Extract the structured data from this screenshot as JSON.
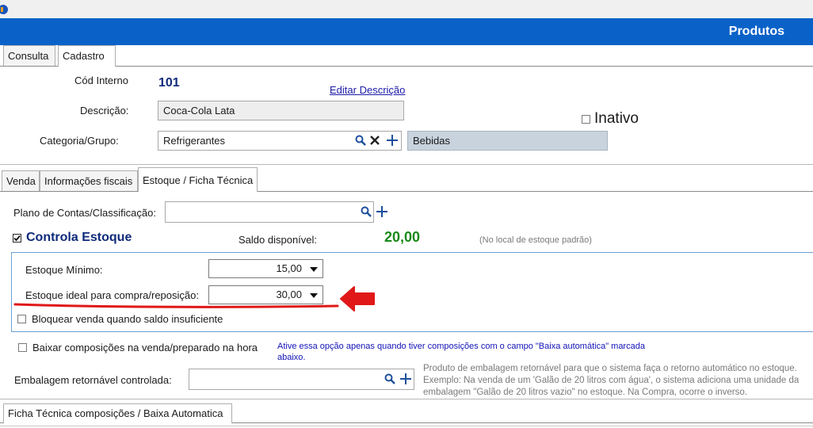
{
  "window": {
    "title": "Produtos"
  },
  "main_tabs": {
    "consulta": "Consulta",
    "cadastro": "Cadastro"
  },
  "cadastro": {
    "cod_interno_label": "Cód Interno",
    "cod_interno_value": "101",
    "editar_descricao": "Editar Descrição",
    "descricao_label": "Descrição:",
    "descricao_value": "Coca-Cola Lata",
    "inativo_label": "Inativo",
    "categoria_label": "Categoria/Grupo:",
    "categoria_value": "Refrigerantes",
    "grupo_value": "Bebidas"
  },
  "sub_tabs": {
    "venda": "Venda",
    "fiscais": "Informações fiscais",
    "estoque": "Estoque / Ficha Técnica"
  },
  "estoque": {
    "plano_contas_label": "Plano de Contas/Classificação:",
    "plano_contas_value": "",
    "controla_estoque_label": "Controla Estoque",
    "controla_estoque_checked": true,
    "saldo_label": "Saldo disponível:",
    "saldo_value": "20,00",
    "saldo_hint": "(No local de estoque padrão)",
    "estoque_minimo_label": "Estoque Mínimo:",
    "estoque_minimo_value": "15,00",
    "estoque_ideal_label": "Estoque ideal para compra/reposição:",
    "estoque_ideal_value": "30,00",
    "bloquear_label": "Bloquear venda quando saldo insuficiente",
    "baixar_label": "Baixar composições na venda/preparado na hora",
    "baixar_hint": "Ative essa opção apenas quando tiver composições com o campo \"Baixa automática\" marcada abaixo.",
    "embalagem_label": "Embalagem retornável controlada:",
    "embalagem_value": "",
    "embalagem_hint": "Produto de embalagem retornável para que o sistema faça o retorno automático no estoque. Exemplo: Na venda de um 'Galão de 20 litros com água', o sistema adiciona uma unidade da embalagem \"Galão de 20 litros vazio\" no estoque. Na Compra, ocorre o inverso."
  },
  "bottom_tab": "Ficha Técnica composições / Baixa Automatica",
  "colors": {
    "titlebar": "#0a62c8",
    "saldo": "#1a8a1a",
    "annotation": "#e01818",
    "link": "#1a1aa8",
    "hint": "#1212b8"
  }
}
